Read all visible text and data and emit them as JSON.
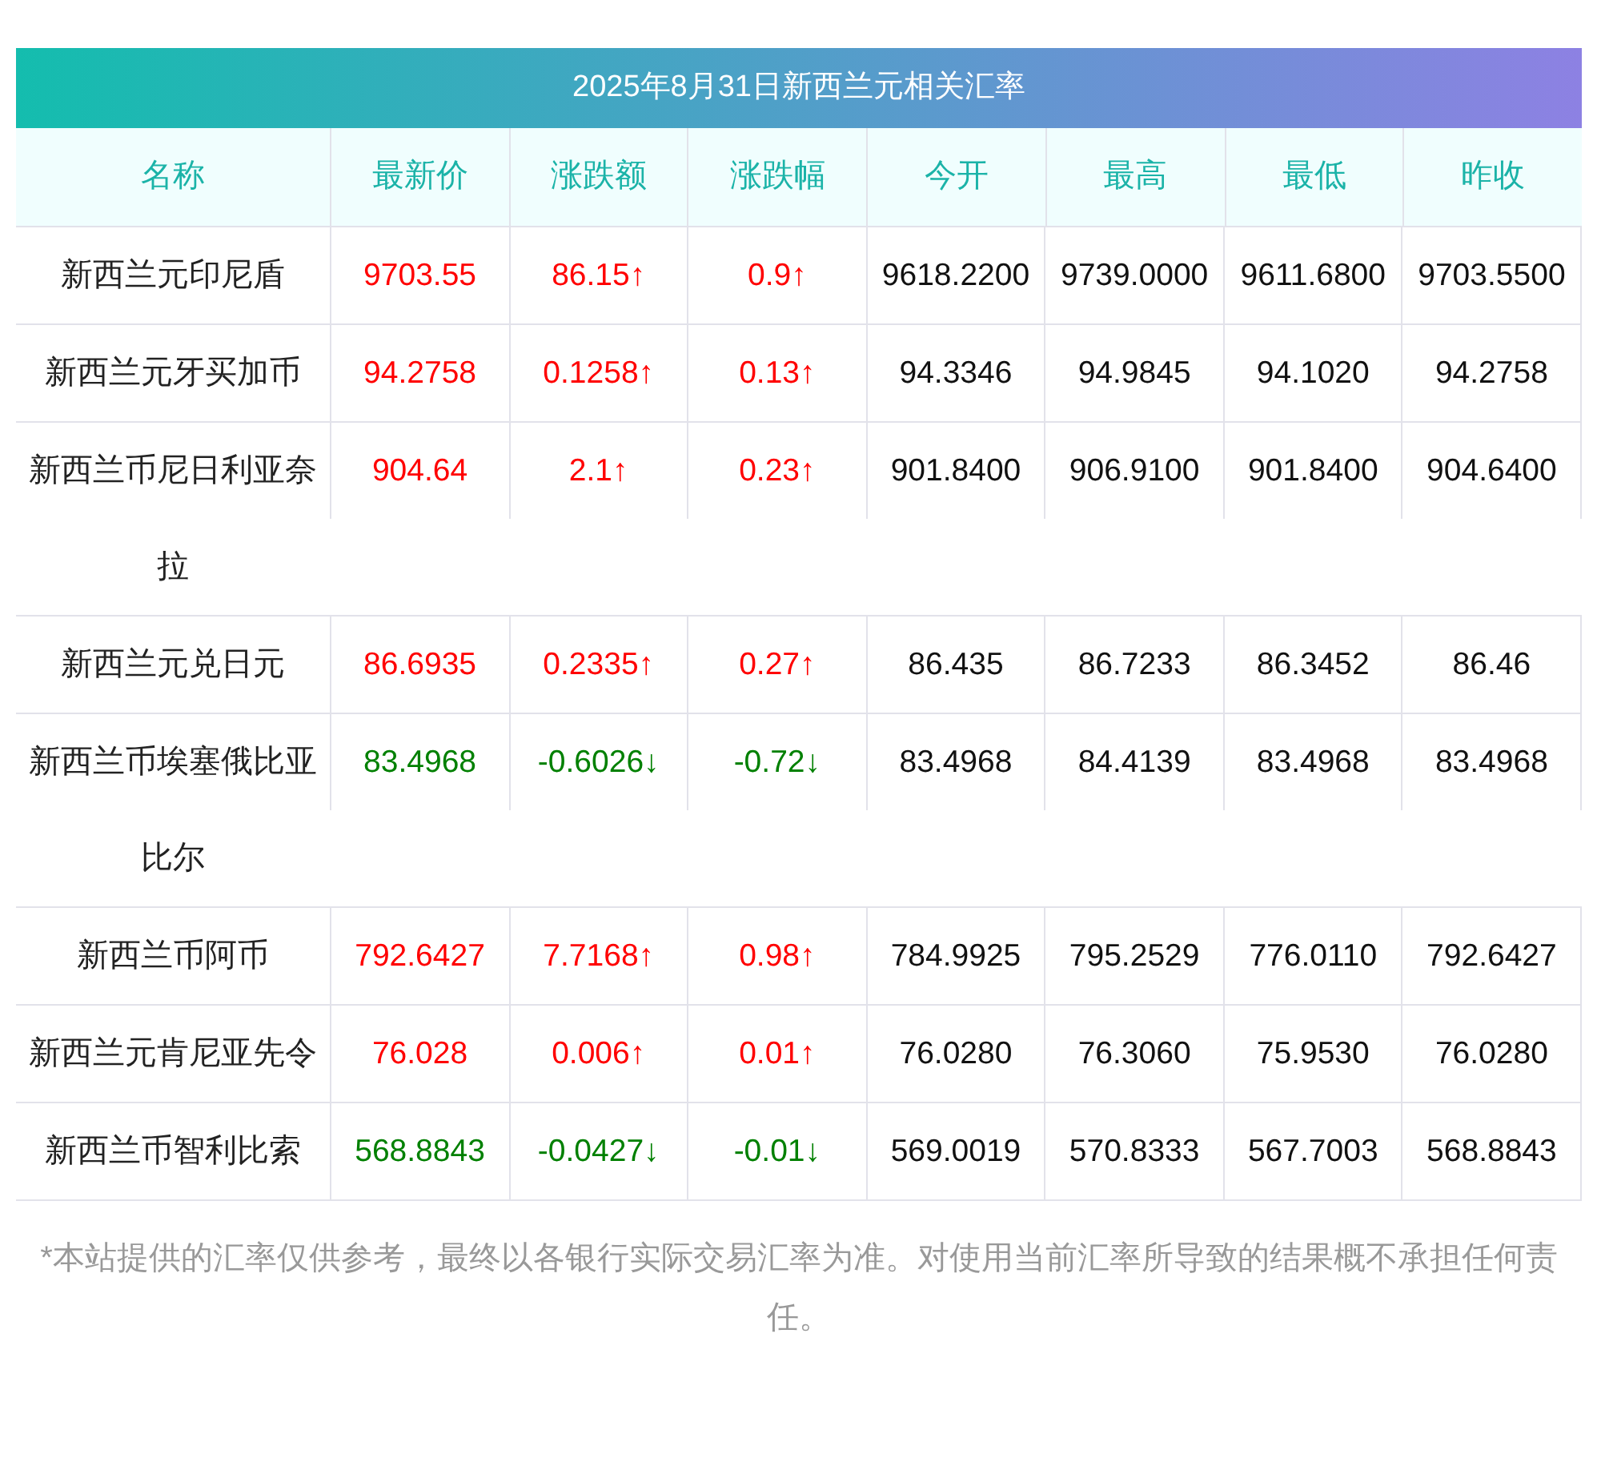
{
  "title": "2025年8月31日新西兰元相关汇率",
  "columns": [
    "名称",
    "最新价",
    "涨跌额",
    "涨跌幅",
    "今开",
    "最高",
    "最低",
    "昨收"
  ],
  "rows": [
    {
      "kind": "up",
      "cells": [
        "新西兰元印尼盾",
        "9703.55",
        "86.15↑",
        "0.9↑",
        "9618.2200",
        "9739.0000",
        "9611.6800",
        "9703.5500"
      ]
    },
    {
      "kind": "up",
      "cells": [
        "新西兰元牙买加币",
        "94.2758",
        "0.1258↑",
        "0.13↑",
        "94.3346",
        "94.9845",
        "94.1020",
        "94.2758"
      ]
    },
    {
      "kind": "up",
      "cells": [
        "新西兰币尼日利亚奈拉",
        "904.64",
        "2.1↑",
        "0.23↑",
        "901.8400",
        "906.9100",
        "901.8400",
        "904.6400"
      ]
    },
    {
      "kind": "up",
      "cells": [
        "新西兰元兑日元",
        "86.6935",
        "0.2335↑",
        "0.27↑",
        "86.435",
        "86.7233",
        "86.3452",
        "86.46"
      ]
    },
    {
      "kind": "down",
      "cells": [
        "新西兰币埃塞俄比亚比尔",
        "83.4968",
        "-0.6026↓",
        "-0.72↓",
        "83.4968",
        "84.4139",
        "83.4968",
        "83.4968"
      ]
    },
    {
      "kind": "up",
      "cells": [
        "新西兰币阿币",
        "792.6427",
        "7.7168↑",
        "0.98↑",
        "784.9925",
        "795.2529",
        "776.0110",
        "792.6427"
      ]
    },
    {
      "kind": "up",
      "cells": [
        "新西兰元肯尼亚先令",
        "76.028",
        "0.006↑",
        "0.01↑",
        "76.0280",
        "76.3060",
        "75.9530",
        "76.0280"
      ]
    },
    {
      "kind": "down",
      "cells": [
        "新西兰币智利比索",
        "568.8843",
        "-0.0427↓",
        "-0.01↓",
        "569.0019",
        "570.8333",
        "567.7003",
        "568.8843"
      ]
    }
  ],
  "footnote": "*本站提供的汇率仅供参考，最终以各银行实际交易汇率为准。对使用当前汇率所导致的结果概不承担任何责任。"
}
